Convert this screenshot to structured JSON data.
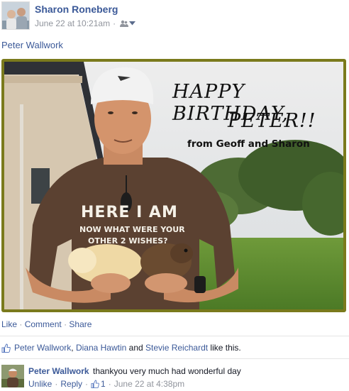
{
  "post": {
    "author": "Sharon Roneberg",
    "timestamp": "June 22 at 10:21am",
    "separator": "·",
    "tagged_user": "Peter Wallwork"
  },
  "photo": {
    "greeting_line1": "HAPPY BIRTHDAY,",
    "greeting_line2": "PETER!!",
    "greeting_line3": "from Geoff and Sharon",
    "shirt_line1": "HERE I AM",
    "shirt_line2": "NOW WHAT WERE YOUR",
    "shirt_line3": "OTHER 2 WISHES?"
  },
  "actions": {
    "like": "Like",
    "comment": "Comment",
    "share": "Share",
    "separator": "·"
  },
  "likes": {
    "user1": "Peter Wallwork",
    "comma": ",",
    "user2": "Diana Hawtin",
    "and": "and",
    "user3": "Stevie Reichardt",
    "suffix": "like this."
  },
  "comment": {
    "author": "Peter Wallwork",
    "text": "thankyou very much had wonderful day",
    "unlike": "Unlike",
    "reply": "Reply",
    "like_count": "1",
    "timestamp": "June 22 at 4:38pm",
    "separator": "·"
  },
  "colors": {
    "link": "#3b5998",
    "meta": "#90949c",
    "frame": "#7a7a1c"
  },
  "icons": [
    "friends-audience-icon",
    "chevron-down-icon",
    "thumbs-up-icon"
  ]
}
